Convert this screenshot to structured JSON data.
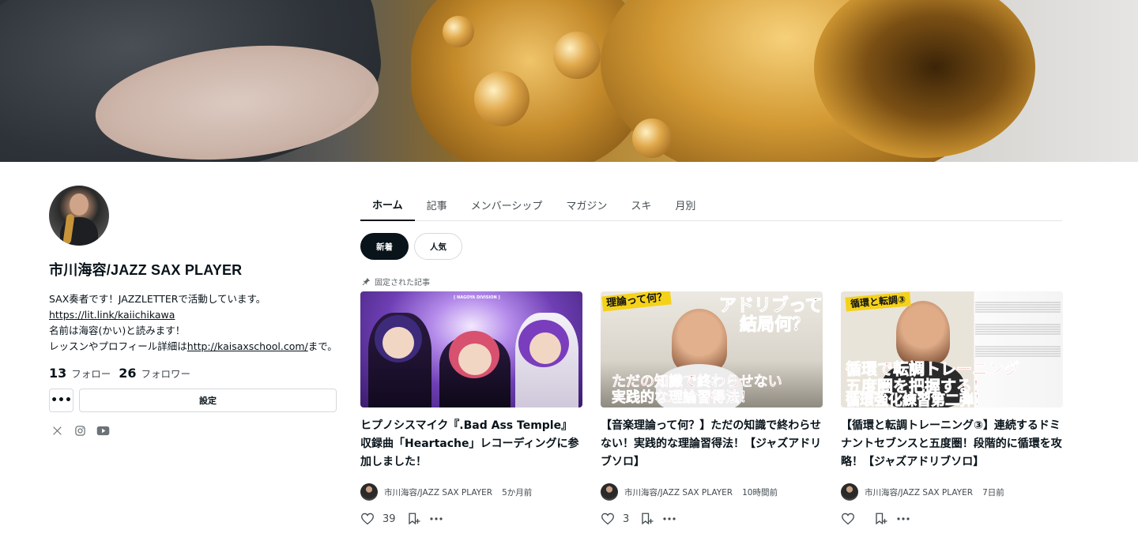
{
  "profile": {
    "name": "市川海容/JAZZ SAX PLAYER",
    "bio_line1": "SAX奏者です！JAZZLETTERで活動しています。",
    "bio_link1": "https://lit.link/kaiichikawa",
    "bio_line3": "名前は海容(かい)と読みます！",
    "bio_line4_prefix": "レッスンやプロフィール詳細は",
    "bio_link2": "http://kaisaxschool.com/",
    "bio_line4_suffix": "まで。",
    "follow_count": "13",
    "follow_label": "フォロー",
    "follower_count": "26",
    "follower_label": "フォロワー",
    "more_label": "•••",
    "settings_label": "設定",
    "social_icons": [
      "x-icon",
      "instagram-icon",
      "youtube-icon"
    ]
  },
  "tabs": [
    {
      "label": "ホーム",
      "active": true
    },
    {
      "label": "記事"
    },
    {
      "label": "メンバーシップ"
    },
    {
      "label": "マガジン"
    },
    {
      "label": "スキ"
    },
    {
      "label": "月別"
    }
  ],
  "filters": {
    "new_label": "新着",
    "popular_label": "人気"
  },
  "pinned_label": "固定された記事",
  "articles": [
    {
      "title": "ヒプノシスマイク『.Bad Ass Temple』収録曲「Heartache」レコーディングに参加しました！",
      "author": "市川海容/JAZZ SAX PLAYER",
      "time": "5か月前",
      "likes": "39",
      "thumb_text": "[ NAGOYA DIVISION ]"
    },
    {
      "title": "【音楽理論って何？】ただの知識で終わらせない！実践的な理論習得法！【ジャズアドリブソロ】",
      "author": "市川海容/JAZZ SAX PLAYER",
      "time": "10時間前",
      "likes": "3",
      "thumb_tag": "理論って何？",
      "thumb_head": "アドリブって",
      "thumb_head2": "結局何？",
      "thumb_foot": "ただの知識で終わらせない",
      "thumb_foot2": "実践的な理論習得法！"
    },
    {
      "title": "【循環と転調トレーニング③】連続するドミナントセブンスと五度圏！段階的に循環を攻略！【ジャズアドリブソロ】",
      "author": "市川海容/JAZZ SAX PLAYER",
      "time": "7日前",
      "likes": "",
      "thumb_tag": "循環と転調③",
      "thumb_line1": "循環で転調トレーニング",
      "thumb_line2": "五度圏を把握する！",
      "thumb_line3": "循環強化練習第二弾！"
    }
  ],
  "colors": {
    "text": "#08131a",
    "muted": "#434b50",
    "border": "#d5d9dc",
    "accent_dark": "#08131a"
  }
}
